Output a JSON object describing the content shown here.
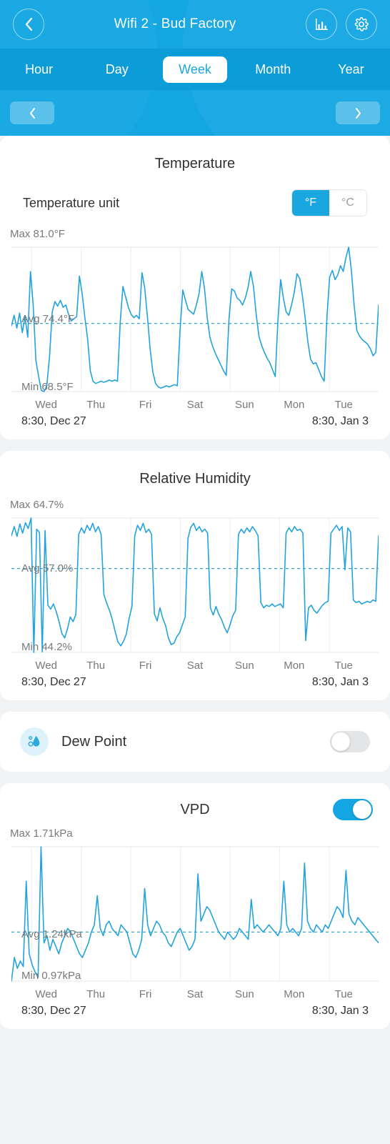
{
  "header": {
    "title": "Wifi 2 - Bud Factory",
    "back_icon": "chevron-left-icon",
    "stats_icon": "bar-chart-icon",
    "settings_icon": "gear-icon",
    "accent": "#13a6e3",
    "tabs": [
      {
        "label": "Hour",
        "active": false
      },
      {
        "label": "Day",
        "active": false
      },
      {
        "label": "Week",
        "active": true
      },
      {
        "label": "Month",
        "active": false
      },
      {
        "label": "Year",
        "active": false
      }
    ],
    "prev_label": "‹",
    "next_label": "›"
  },
  "temperature": {
    "title": "Temperature",
    "unit_label": "Temperature unit",
    "unit_options": [
      "°F",
      "°C"
    ],
    "unit_selected": "°F",
    "max_text": "Max 81.0°F",
    "avg_text": "Avg 74.4°F",
    "min_text": "Min 68.5°F",
    "start_time": "8:30,  Dec 27",
    "end_time": "8:30,  Jan 3"
  },
  "humidity": {
    "title": "Relative Humidity",
    "max_text": "Max 64.7%",
    "avg_text": "Avg 57.0%",
    "min_text": "Min 44.2%",
    "start_time": "8:30,  Dec 27",
    "end_time": "8:30,  Jan 3"
  },
  "dew_point": {
    "label": "Dew Point",
    "icon": "dew-drop-icon",
    "enabled": false
  },
  "vpd": {
    "title": "VPD",
    "enabled": true,
    "max_text": "Max 1.71kPa",
    "avg_text": "Avg 1.24kPa",
    "min_text": "Min 0.97kPa",
    "start_time": "8:30,  Dec 27",
    "end_time": "8:30,  Jan 3"
  },
  "days": [
    "Wed",
    "Thu",
    "Fri",
    "Sat",
    "Sun",
    "Mon",
    "Tue"
  ],
  "chart_data": [
    {
      "type": "line",
      "title": "Temperature",
      "ylabel": "°F",
      "xlabel": "",
      "categories": [
        "Wed",
        "Thu",
        "Fri",
        "Sat",
        "Sun",
        "Mon",
        "Tue"
      ],
      "ylim": [
        68.5,
        81.0
      ],
      "max": 81.0,
      "avg": 74.4,
      "min": 68.5,
      "unit": "°F",
      "grid": true,
      "legend": "none",
      "x_start": "8:30, Dec 27",
      "x_end": "8:30, Jan 3",
      "values": [
        74.2,
        75.1,
        74.0,
        75.3,
        73.6,
        75.0,
        73.2,
        78.9,
        76.0,
        71.2,
        69.8,
        68.6,
        68.5,
        69.0,
        71.5,
        75.4,
        76.3,
        75.9,
        76.4,
        75.8,
        76.0,
        75.2,
        74.6,
        74.8,
        75.0,
        78.5,
        77.0,
        74.9,
        73.1,
        70.3,
        69.4,
        69.2,
        69.3,
        69.4,
        69.3,
        69.4,
        69.5,
        69.4,
        69.5,
        69.4,
        74.5,
        77.6,
        76.7,
        75.8,
        75.2,
        74.9,
        75.1,
        74.8,
        78.8,
        77.5,
        75.0,
        72.2,
        70.2,
        69.2,
        68.9,
        68.8,
        68.9,
        69.0,
        68.9,
        69.0,
        69.1,
        69.0,
        73.8,
        77.3,
        76.4,
        75.6,
        75.4,
        75.2,
        76.0,
        77.0,
        78.9,
        77.4,
        74.9,
        73.2,
        72.4,
        71.8,
        71.3,
        70.8,
        70.3,
        69.9,
        74.8,
        77.4,
        77.2,
        76.6,
        76.4,
        76.0,
        76.6,
        77.5,
        78.9,
        77.6,
        75.2,
        73.3,
        72.5,
        71.9,
        71.4,
        71.0,
        70.4,
        69.8,
        74.7,
        78.2,
        76.6,
        75.4,
        75.1,
        76.0,
        77.1,
        78.7,
        78.3,
        76.8,
        74.9,
        72.8,
        71.3,
        70.9,
        71.0,
        70.4,
        69.8,
        69.4,
        74.9,
        78.4,
        79.0,
        78.2,
        78.6,
        79.4,
        78.9,
        80.1,
        81.0,
        79.0,
        76.0,
        73.8,
        73.3,
        73.0,
        72.8,
        72.6,
        72.2,
        71.6,
        71.9,
        76.0
      ]
    },
    {
      "type": "line",
      "title": "Relative Humidity",
      "ylabel": "%",
      "xlabel": "",
      "categories": [
        "Wed",
        "Thu",
        "Fri",
        "Sat",
        "Sun",
        "Mon",
        "Tue"
      ],
      "ylim": [
        44.2,
        64.7
      ],
      "max": 64.7,
      "avg": 57.0,
      "min": 44.2,
      "unit": "%",
      "grid": true,
      "legend": "none",
      "x_start": "8:30, Dec 27",
      "x_end": "8:30, Jan 3",
      "values": [
        62.0,
        63.4,
        61.9,
        63.8,
        62.4,
        64.0,
        63.1,
        64.7,
        44.2,
        63.0,
        62.5,
        44.3,
        62.8,
        51.4,
        50.8,
        51.6,
        50.4,
        48.9,
        47.1,
        46.4,
        47.8,
        49.6,
        48.9,
        50.0,
        62.2,
        63.2,
        62.4,
        63.6,
        62.8,
        63.9,
        62.6,
        63.4,
        62.2,
        53.0,
        51.7,
        50.6,
        49.2,
        47.4,
        45.8,
        45.2,
        45.9,
        47.0,
        49.4,
        51.2,
        62.0,
        63.6,
        62.8,
        63.9,
        62.5,
        63.0,
        62.2,
        50.1,
        49.0,
        51.0,
        49.4,
        48.3,
        46.4,
        45.4,
        45.6,
        46.6,
        47.2,
        48.4,
        49.6,
        61.6,
        63.3,
        63.9,
        62.8,
        63.4,
        62.6,
        63.0,
        62.4,
        51.0,
        49.9,
        51.2,
        50.0,
        49.2,
        48.0,
        47.2,
        48.4,
        49.8,
        50.6,
        62.2,
        63.0,
        62.4,
        63.2,
        62.6,
        63.4,
        62.8,
        62.0,
        51.8,
        51.0,
        51.4,
        51.2,
        51.6,
        51.2,
        51.4,
        51.6,
        51.0,
        62.4,
        63.2,
        62.6,
        63.4,
        62.8,
        63.0,
        62.4,
        46.0,
        51.0,
        51.4,
        50.6,
        50.2,
        50.8,
        51.4,
        51.8,
        52.0,
        62.4,
        63.0,
        63.6,
        62.8,
        63.4,
        56.8,
        63.2,
        62.6,
        52.2,
        51.8,
        52.0,
        51.6,
        51.8,
        52.0,
        51.8,
        52.2,
        52.0,
        62.0
      ]
    },
    {
      "type": "line",
      "title": "VPD",
      "ylabel": "kPa",
      "xlabel": "",
      "categories": [
        "Wed",
        "Thu",
        "Fri",
        "Sat",
        "Sun",
        "Mon",
        "Tue"
      ],
      "ylim": [
        0.97,
        1.71
      ],
      "max": 1.71,
      "avg": 1.24,
      "min": 0.97,
      "unit": "kPa",
      "grid": true,
      "legend": "none",
      "x_start": "8:30, Dec 27",
      "x_end": "8:30, Jan 3",
      "values": [
        0.97,
        1.1,
        1.04,
        1.08,
        1.05,
        1.52,
        1.12,
        1.06,
        1.02,
        0.99,
        1.71,
        1.18,
        1.22,
        1.14,
        1.2,
        1.16,
        1.12,
        1.18,
        1.22,
        1.26,
        1.24,
        1.2,
        1.16,
        1.12,
        1.1,
        1.14,
        1.18,
        1.24,
        1.28,
        1.44,
        1.26,
        1.22,
        1.28,
        1.3,
        1.26,
        1.24,
        1.22,
        1.28,
        1.26,
        1.24,
        1.18,
        1.12,
        1.1,
        1.14,
        1.2,
        1.48,
        1.28,
        1.22,
        1.26,
        1.3,
        1.28,
        1.24,
        1.22,
        1.18,
        1.16,
        1.2,
        1.24,
        1.26,
        1.22,
        1.18,
        1.14,
        1.16,
        1.2,
        1.56,
        1.3,
        1.34,
        1.38,
        1.36,
        1.32,
        1.28,
        1.24,
        1.22,
        1.2,
        1.24,
        1.22,
        1.2,
        1.22,
        1.26,
        1.24,
        1.22,
        1.2,
        1.42,
        1.26,
        1.28,
        1.26,
        1.24,
        1.26,
        1.28,
        1.26,
        1.24,
        1.22,
        1.26,
        1.52,
        1.28,
        1.24,
        1.26,
        1.24,
        1.22,
        1.26,
        1.62,
        1.3,
        1.26,
        1.24,
        1.28,
        1.26,
        1.24,
        1.28,
        1.26,
        1.3,
        1.34,
        1.38,
        1.36,
        1.32,
        1.58,
        1.34,
        1.3,
        1.28,
        1.32,
        1.3,
        1.28,
        1.26,
        1.24,
        1.22,
        1.2,
        1.18
      ]
    }
  ]
}
